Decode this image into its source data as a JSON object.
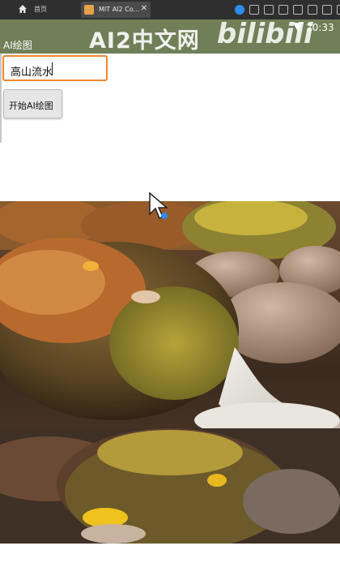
{
  "browser": {
    "home_label": "首页",
    "tab_title": "MIT AI2 Co...",
    "tab_close": "✕"
  },
  "overlay": {
    "watermark": "AI2中文网",
    "bili": "bilibili"
  },
  "status": {
    "time": "20:33"
  },
  "app": {
    "title": "AI绘图"
  },
  "prompt_input": {
    "value": "高山流水"
  },
  "draw_button": {
    "label": "开始AI绘图"
  },
  "colors": {
    "appbar": "#707f58",
    "input_focus_border": "#f0882e"
  }
}
